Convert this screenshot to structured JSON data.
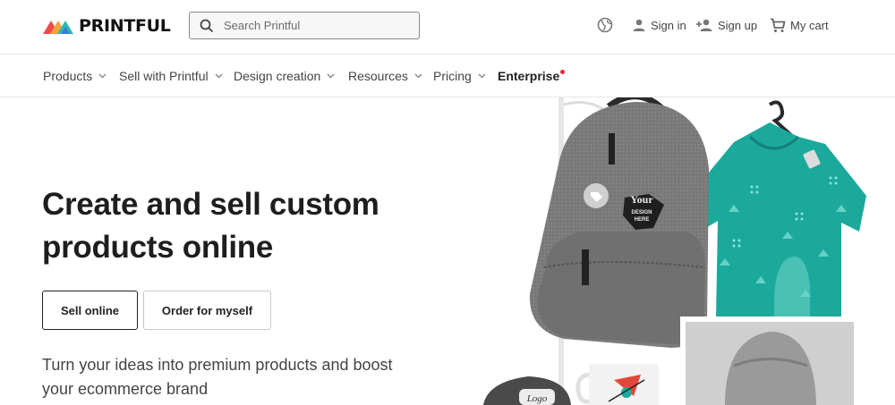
{
  "brand": {
    "name": "PRINTFUL",
    "colors": {
      "red": "#ef4b4b",
      "orange": "#f7a23b",
      "teal": "#2bb8b0",
      "blue": "#3b7dd8"
    }
  },
  "search": {
    "placeholder": "Search Printful",
    "value": ""
  },
  "header": {
    "globe_icon": "globe-icon",
    "sign_in": "Sign in",
    "sign_up": "Sign up",
    "cart": "My cart"
  },
  "nav": {
    "items": [
      {
        "label": "Products"
      },
      {
        "label": "Sell with Printful"
      },
      {
        "label": "Design creation"
      },
      {
        "label": "Resources"
      },
      {
        "label": "Pricing"
      },
      {
        "label": "Enterprise"
      }
    ]
  },
  "hero": {
    "title_line1": "Create and sell custom",
    "title_line2": "products online",
    "primary_button": "Sell online",
    "secondary_button": "Order for myself",
    "subtitle_line1": "Turn your ideas into premium products and boost",
    "subtitle_line2": "your ecommerce brand",
    "art": {
      "backpack_print_lines": [
        "Your",
        "DESIGN",
        "HERE"
      ],
      "cap_print": "Logo",
      "tshirt_color": "#1ba99c"
    }
  }
}
